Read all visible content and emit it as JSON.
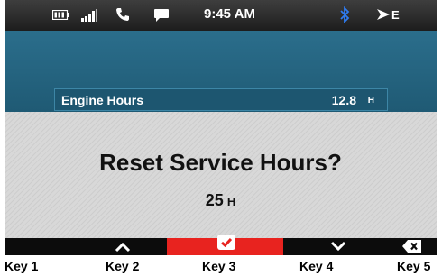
{
  "status_bar": {
    "time": "9:45 AM",
    "icons": [
      "battery-icon",
      "signal-icon",
      "phone-icon",
      "message-icon",
      "bluetooth-icon",
      "compass-icon"
    ],
    "heading": "E"
  },
  "engine_hours": {
    "label": "Engine Hours",
    "value": "12.8",
    "unit": "H"
  },
  "dialog": {
    "title": "Reset Service Hours?",
    "value": "25",
    "unit": "H"
  },
  "softkeys": [
    "",
    "up-arrow-icon",
    "check-icon",
    "down-arrow-icon",
    "backspace-icon"
  ],
  "key_labels": [
    "Key 1",
    "Key 2",
    "Key 3",
    "Key 4",
    "Key 5"
  ],
  "colors": {
    "confirm_key": "#e8231f",
    "header_blue": "#2b6e8c",
    "status_bar": "#2a2a2a"
  }
}
